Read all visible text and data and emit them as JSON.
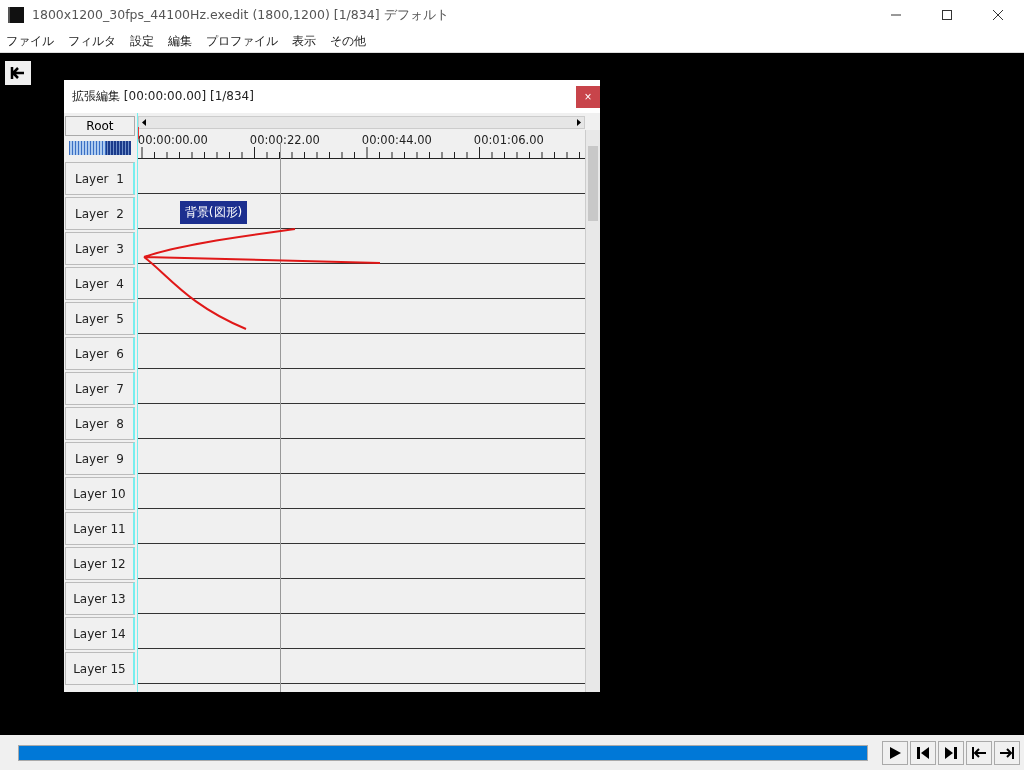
{
  "window": {
    "title": "1800x1200_30fps_44100Hz.exedit (1800,1200)  [1/834]  デフォルト"
  },
  "menu": [
    "ファイル",
    "フィルタ",
    "設定",
    "編集",
    "プロファイル",
    "表示",
    "その他"
  ],
  "timeline": {
    "title": "拡張編集 [00:00:00.00] [1/834]",
    "close": "×",
    "root": "Root",
    "zoom": {
      "level": 0.6
    },
    "ticks": [
      "00:00:00.00",
      "00:00:22.00",
      "00:00:44.00",
      "00:01:06.00"
    ],
    "layers": [
      {
        "name": "Layer  1"
      },
      {
        "name": "Layer  2",
        "clip": "背景(図形)"
      },
      {
        "name": "Layer  3"
      },
      {
        "name": "Layer  4"
      },
      {
        "name": "Layer  5"
      },
      {
        "name": "Layer  6"
      },
      {
        "name": "Layer  7"
      },
      {
        "name": "Layer  8"
      },
      {
        "name": "Layer  9"
      },
      {
        "name": "Layer 10"
      },
      {
        "name": "Layer 11"
      },
      {
        "name": "Layer 12"
      },
      {
        "name": "Layer 13"
      },
      {
        "name": "Layer 14"
      },
      {
        "name": "Layer 15"
      }
    ]
  },
  "transport": [
    {
      "kind": "play"
    },
    {
      "kind": "prev-frame"
    },
    {
      "kind": "next-frame"
    },
    {
      "kind": "start"
    },
    {
      "kind": "end"
    }
  ]
}
